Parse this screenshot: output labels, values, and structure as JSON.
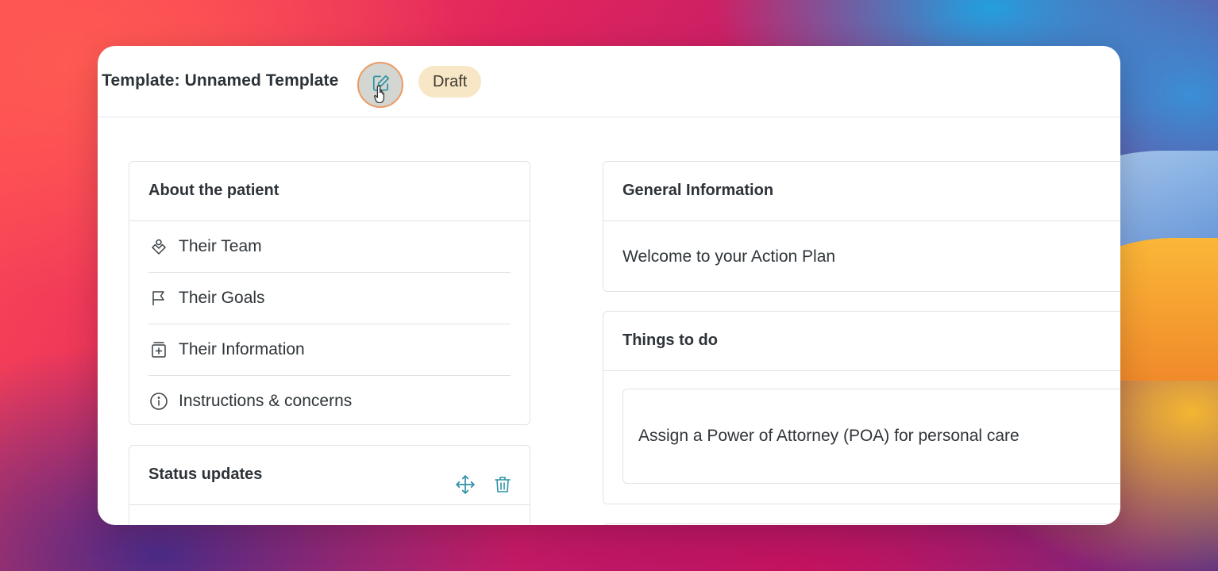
{
  "header": {
    "title": "ew Template: Unnamed Template",
    "status_badge": "Draft"
  },
  "about_card": {
    "title": "About the patient",
    "items": [
      {
        "label": "Their Team",
        "icon": "team-icon"
      },
      {
        "label": "Their Goals",
        "icon": "flag-icon"
      },
      {
        "label": "Their Information",
        "icon": "info-box-icon"
      },
      {
        "label": "Instructions & concerns",
        "icon": "info-circle-icon"
      }
    ]
  },
  "status_card": {
    "title": "Status updates",
    "actions": [
      "move-icon",
      "trash-icon"
    ]
  },
  "general_card": {
    "title": "General Information",
    "body": "Welcome to your Action Plan"
  },
  "things_card": {
    "title": "Things to do",
    "tasks": [
      "Assign a Power of Attorney (POA) for personal care"
    ]
  },
  "colors": {
    "accent": "#2e93a6",
    "badge_bg": "#f7e7c6",
    "text": "#2f3539",
    "border": "#dfe3e7"
  }
}
